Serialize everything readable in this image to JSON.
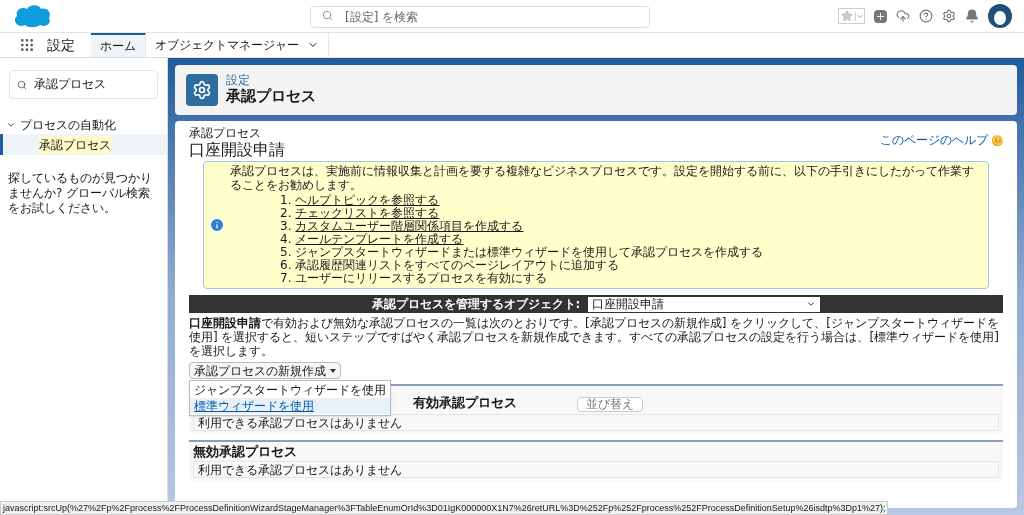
{
  "header": {
    "search": {
      "placeholder": "[設定] を検索"
    }
  },
  "nav": {
    "app_name": "設定",
    "tabs": [
      {
        "label": "ホーム",
        "selected": true,
        "dropdown": false
      },
      {
        "label": "オブジェクトマネージャー",
        "selected": false,
        "dropdown": true
      }
    ]
  },
  "sidebar": {
    "search": {
      "value": "承認プロセス"
    },
    "tree": [
      {
        "label": "プロセスの自動化",
        "expanded": true,
        "children": [
          {
            "label": "承認プロセス",
            "selected": true
          }
        ]
      }
    ],
    "help_text": "探しているものが見つかりませんか? グローバル検索をお試しください。"
  },
  "page_header": {
    "breadcrumb": "設定",
    "title": "承認プロセス"
  },
  "content": {
    "breadcrumb": "承認プロセス",
    "title": "口座開設申請",
    "help_link": "このページのヘルプ",
    "info": {
      "intro": "承認プロセスは、実施前に情報収集と計画を要する複雑なビジネスプロセスです。設定を開始する前に、以下の手引きにしたがって作業することをお勧めします。",
      "steps": [
        {
          "number": "1.",
          "label": "ヘルプトピックを参照する",
          "link": true
        },
        {
          "number": "2.",
          "label": "チェックリストを参照する",
          "link": true
        },
        {
          "number": "3.",
          "label": "カスタムユーザー階層関係項目を作成する",
          "link": true
        },
        {
          "number": "4.",
          "label": "メールテンプレートを作成する",
          "link": true
        },
        {
          "number": "5.",
          "label": "ジャンプスタートウィザードまたは標準ウィザードを使用して承認プロセスを作成する",
          "link": false
        },
        {
          "number": "6.",
          "label": "承認履歴関連リストをすべてのページレイアウトに追加する",
          "link": false
        },
        {
          "number": "7.",
          "label": "ユーザーにリリースするプロセスを有効にする",
          "link": false
        }
      ]
    },
    "object_bar": {
      "label": "承認プロセスを管理するオブジェクト:",
      "value": "口座開設申請"
    },
    "description": "**口座開設申請**で有効および無効な承認プロセスの一覧は次のとおりです。[承認プロセスの新規作成] をクリックして、[ジャンプスタートウィザードを使用] を選択すると、短いステップですばやく承認プロセスを新規作成できます。すべての承認プロセスの設定を行う場合は、[標準ウィザードを使用] を選択します。",
    "new_button": "承認プロセスの新規作成",
    "menu": [
      {
        "label": "ジャンプスタートウィザードを使用",
        "selected": false
      },
      {
        "label": "標準ウィザードを使用",
        "selected": true
      }
    ],
    "sections": [
      {
        "title": "有効承認プロセス",
        "sort_button": "並び替え",
        "empty": "利用できる承認プロセスはありません"
      },
      {
        "title": "無効承認プロセス",
        "empty": "利用できる承認プロセスはありません"
      }
    ]
  },
  "status_bar": "javascript:srcUp(%27%2Fp%2Fprocess%2FProcessDefinitionWizardStageManager%3FTableEnumOrId%3D01IgK000000X1N7%26retURL%3D%252Fp%252Fprocess%252FProcessDefinitionSetup%26isdtp%3Dp1%27);"
}
